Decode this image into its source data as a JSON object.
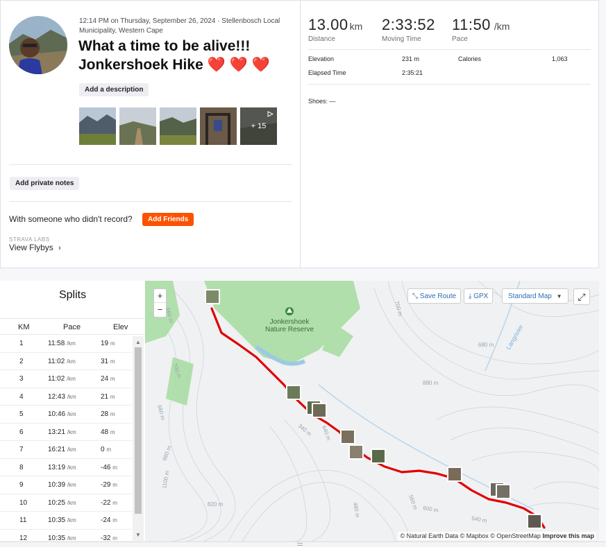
{
  "activity": {
    "meta": "12:14 PM on Thursday, September 26, 2024 · Stellenbosch Local Municipality, Western Cape",
    "title": "What a time to be alive!!! Jonkershoek Hike",
    "hearts": "❤️ ❤️ ❤️",
    "add_description": "Add a description",
    "more_photos": "+ 15",
    "add_private_notes": "Add private notes",
    "friends_question": "With someone who didn't record?",
    "add_friends": "Add Friends",
    "labs_label": "STRAVA LABS",
    "flybys": "View Flybys"
  },
  "stats": {
    "distance": {
      "value": "13.00",
      "unit": "km",
      "label": "Distance"
    },
    "moving_time": {
      "value": "2:33:52",
      "label": "Moving Time"
    },
    "pace": {
      "value": "11:50",
      "unit": "/km",
      "label": "Pace"
    },
    "elevation_label": "Elevation",
    "elevation_value": "231 m",
    "calories_label": "Calories",
    "calories_value": "1,063",
    "elapsed_label": "Elapsed Time",
    "elapsed_value": "2:35:21",
    "shoes": "Shoes: —"
  },
  "splits": {
    "title": "Splits",
    "headers": {
      "km": "KM",
      "pace": "Pace",
      "elev": "Elev"
    },
    "pace_unit": "/km",
    "elev_unit": "m",
    "rows": [
      {
        "km": "1",
        "pace": "11:58",
        "elev": "19"
      },
      {
        "km": "2",
        "pace": "11:02",
        "elev": "31"
      },
      {
        "km": "3",
        "pace": "11:02",
        "elev": "24"
      },
      {
        "km": "4",
        "pace": "12:43",
        "elev": "21"
      },
      {
        "km": "5",
        "pace": "10:46",
        "elev": "28"
      },
      {
        "km": "6",
        "pace": "13:21",
        "elev": "48"
      },
      {
        "km": "7",
        "pace": "16:21",
        "elev": "0"
      },
      {
        "km": "8",
        "pace": "13:19",
        "elev": "-46"
      },
      {
        "km": "9",
        "pace": "10:39",
        "elev": "-29"
      },
      {
        "km": "10",
        "pace": "10:25",
        "elev": "-22"
      },
      {
        "km": "11",
        "pace": "10:35",
        "elev": "-24"
      },
      {
        "km": "12",
        "pace": "10:35",
        "elev": "-32"
      }
    ]
  },
  "map": {
    "zoom_in": "+",
    "zoom_out": "−",
    "save_route": "Save Route",
    "gpx": "GPX",
    "map_style": "Standard Map",
    "reserve_name_1": "Jonkershoek",
    "reserve_name_2": "Nature Reserve",
    "river": "Langrivier",
    "contours": [
      "660 m",
      "700 m",
      "680 m",
      "640 m",
      "660 m",
      "340 m",
      "480 m",
      "600 m",
      "540 m",
      "560 m",
      "820 m",
      "1100 m",
      "880 m",
      "660 m",
      "700 m"
    ],
    "attribution_prefix": "© Natural Earth Data © Mapbox © OpenStreetMap",
    "attribution_link": "Improve this map",
    "route_color": "#e00000",
    "green_color": "#a6dca0"
  }
}
